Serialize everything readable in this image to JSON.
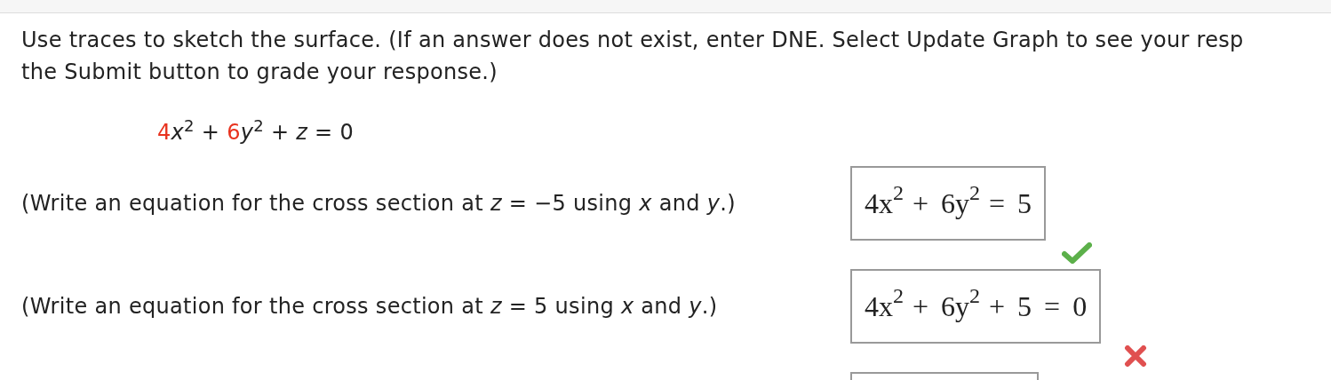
{
  "instructions": "Use traces to sketch the surface. (If an answer does not exist, enter DNE. Select Update Graph to see your resp",
  "instructions_line_2": "the Submit button to grade your response.)",
  "equation": [
    {
      "text": "4",
      "highlighted": true
    },
    {
      "text": "*x*$^{2}$ + ",
      "highlighted": false
    },
    {
      "text": "6",
      "highlighted": true
    },
    {
      "text": "*y*$^{2}$ + *z* = 0",
      "highlighted": false
    }
  ],
  "questions": [
    {
      "prompt": "(Write an equation for the cross section at *z* = −5 using *x* and *y*.)",
      "answer": "4x$^{2}$ + 6y$^{2}$ = 5",
      "correct": true
    },
    {
      "prompt": "(Write an equation for the cross section at *z* = 5 using *x* and *y*.)",
      "answer": "4x$^{2}$ + 6y$^{2}$ + 5 = 0",
      "correct": false
    }
  ]
}
